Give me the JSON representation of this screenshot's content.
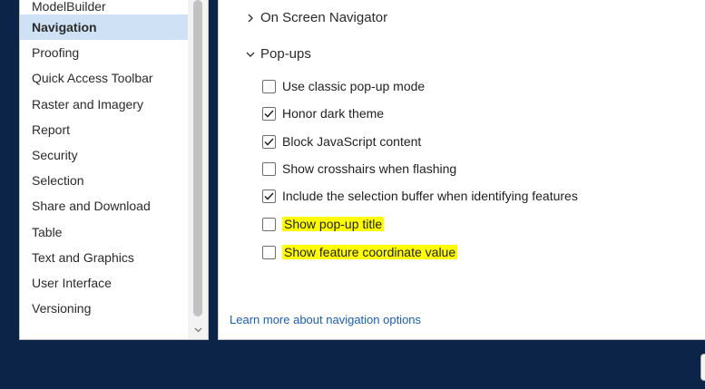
{
  "sidebar": {
    "items": [
      {
        "label": "ModelBuilder",
        "selected": false
      },
      {
        "label": "Navigation",
        "selected": true
      },
      {
        "label": "Proofing",
        "selected": false
      },
      {
        "label": "Quick Access Toolbar",
        "selected": false
      },
      {
        "label": "Raster and Imagery",
        "selected": false
      },
      {
        "label": "Report",
        "selected": false
      },
      {
        "label": "Security",
        "selected": false
      },
      {
        "label": "Selection",
        "selected": false
      },
      {
        "label": "Share and Download",
        "selected": false
      },
      {
        "label": "Table",
        "selected": false
      },
      {
        "label": "Text and Graphics",
        "selected": false
      },
      {
        "label": "User Interface",
        "selected": false
      },
      {
        "label": "Versioning",
        "selected": false
      }
    ]
  },
  "content": {
    "sections": [
      {
        "label": "On Screen Navigator",
        "expanded": false,
        "icon": "chevron-right-icon"
      },
      {
        "label": "Pop-ups",
        "expanded": true,
        "icon": "chevron-down-icon"
      }
    ],
    "options": [
      {
        "label": "Use classic pop-up mode",
        "checked": false,
        "highlighted": false
      },
      {
        "label": "Honor dark theme",
        "checked": true,
        "highlighted": false
      },
      {
        "label": "Block JavaScript content",
        "checked": true,
        "highlighted": false
      },
      {
        "label": "Show crosshairs when flashing",
        "checked": false,
        "highlighted": false
      },
      {
        "label": "Include the selection buffer when identifying features",
        "checked": true,
        "highlighted": false
      },
      {
        "label": "Show pop-up title",
        "checked": false,
        "highlighted": true
      },
      {
        "label": "Show feature coordinate value",
        "checked": false,
        "highlighted": true
      }
    ],
    "learn_more_link": "Learn more about navigation options"
  },
  "colors": {
    "background": "#0b2447",
    "selected_item": "#cfe2f5",
    "highlight": "#ffff00",
    "link": "#1a5fb4"
  }
}
